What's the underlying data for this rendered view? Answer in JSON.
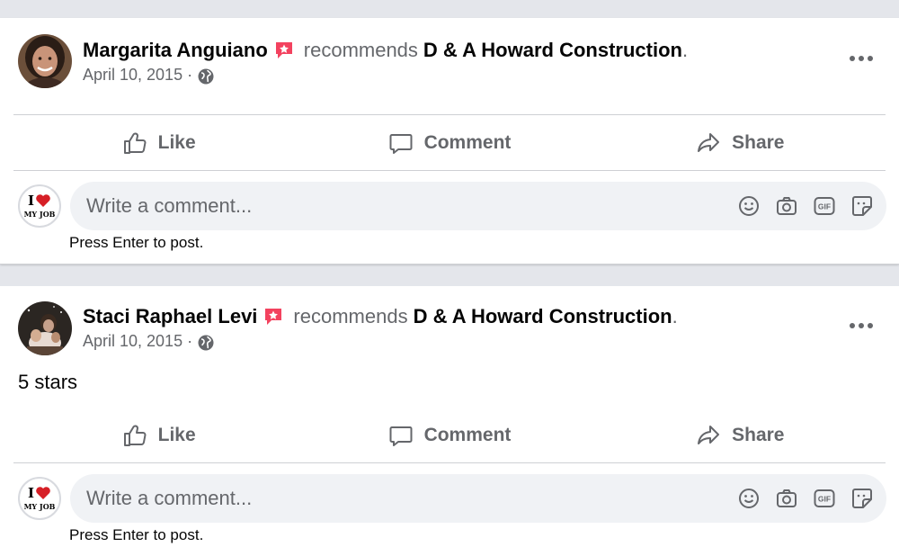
{
  "posts": [
    {
      "author": "Margarita Anguiano",
      "verb": "recommends",
      "page": "D & A Howard Construction",
      "date": "April 10, 2015",
      "text": "",
      "actions": {
        "like": "Like",
        "comment": "Comment",
        "share": "Share"
      }
    },
    {
      "author": "Staci Raphael Levi",
      "verb": "recommends",
      "page": "D & A Howard Construction",
      "date": "April 10, 2015",
      "text": "5 stars",
      "actions": {
        "like": "Like",
        "comment": "Comment",
        "share": "Share"
      }
    }
  ],
  "comment_box": {
    "placeholder": "Write a comment...",
    "hint": "Press Enter to post.",
    "avatar_text_1": "I",
    "avatar_text_2": "MY JOB"
  },
  "meta_separator": "·",
  "period": ".",
  "colors": {
    "recommend_badge": "#f3425f",
    "secondary_text": "#65676b",
    "comment_bg": "#f0f2f5"
  },
  "icons": [
    "recommend-badge-icon",
    "globe-icon",
    "more-icon",
    "like-icon",
    "comment-icon",
    "share-icon",
    "emoji-icon",
    "camera-icon",
    "gif-icon",
    "sticker-icon",
    "heart-icon"
  ]
}
